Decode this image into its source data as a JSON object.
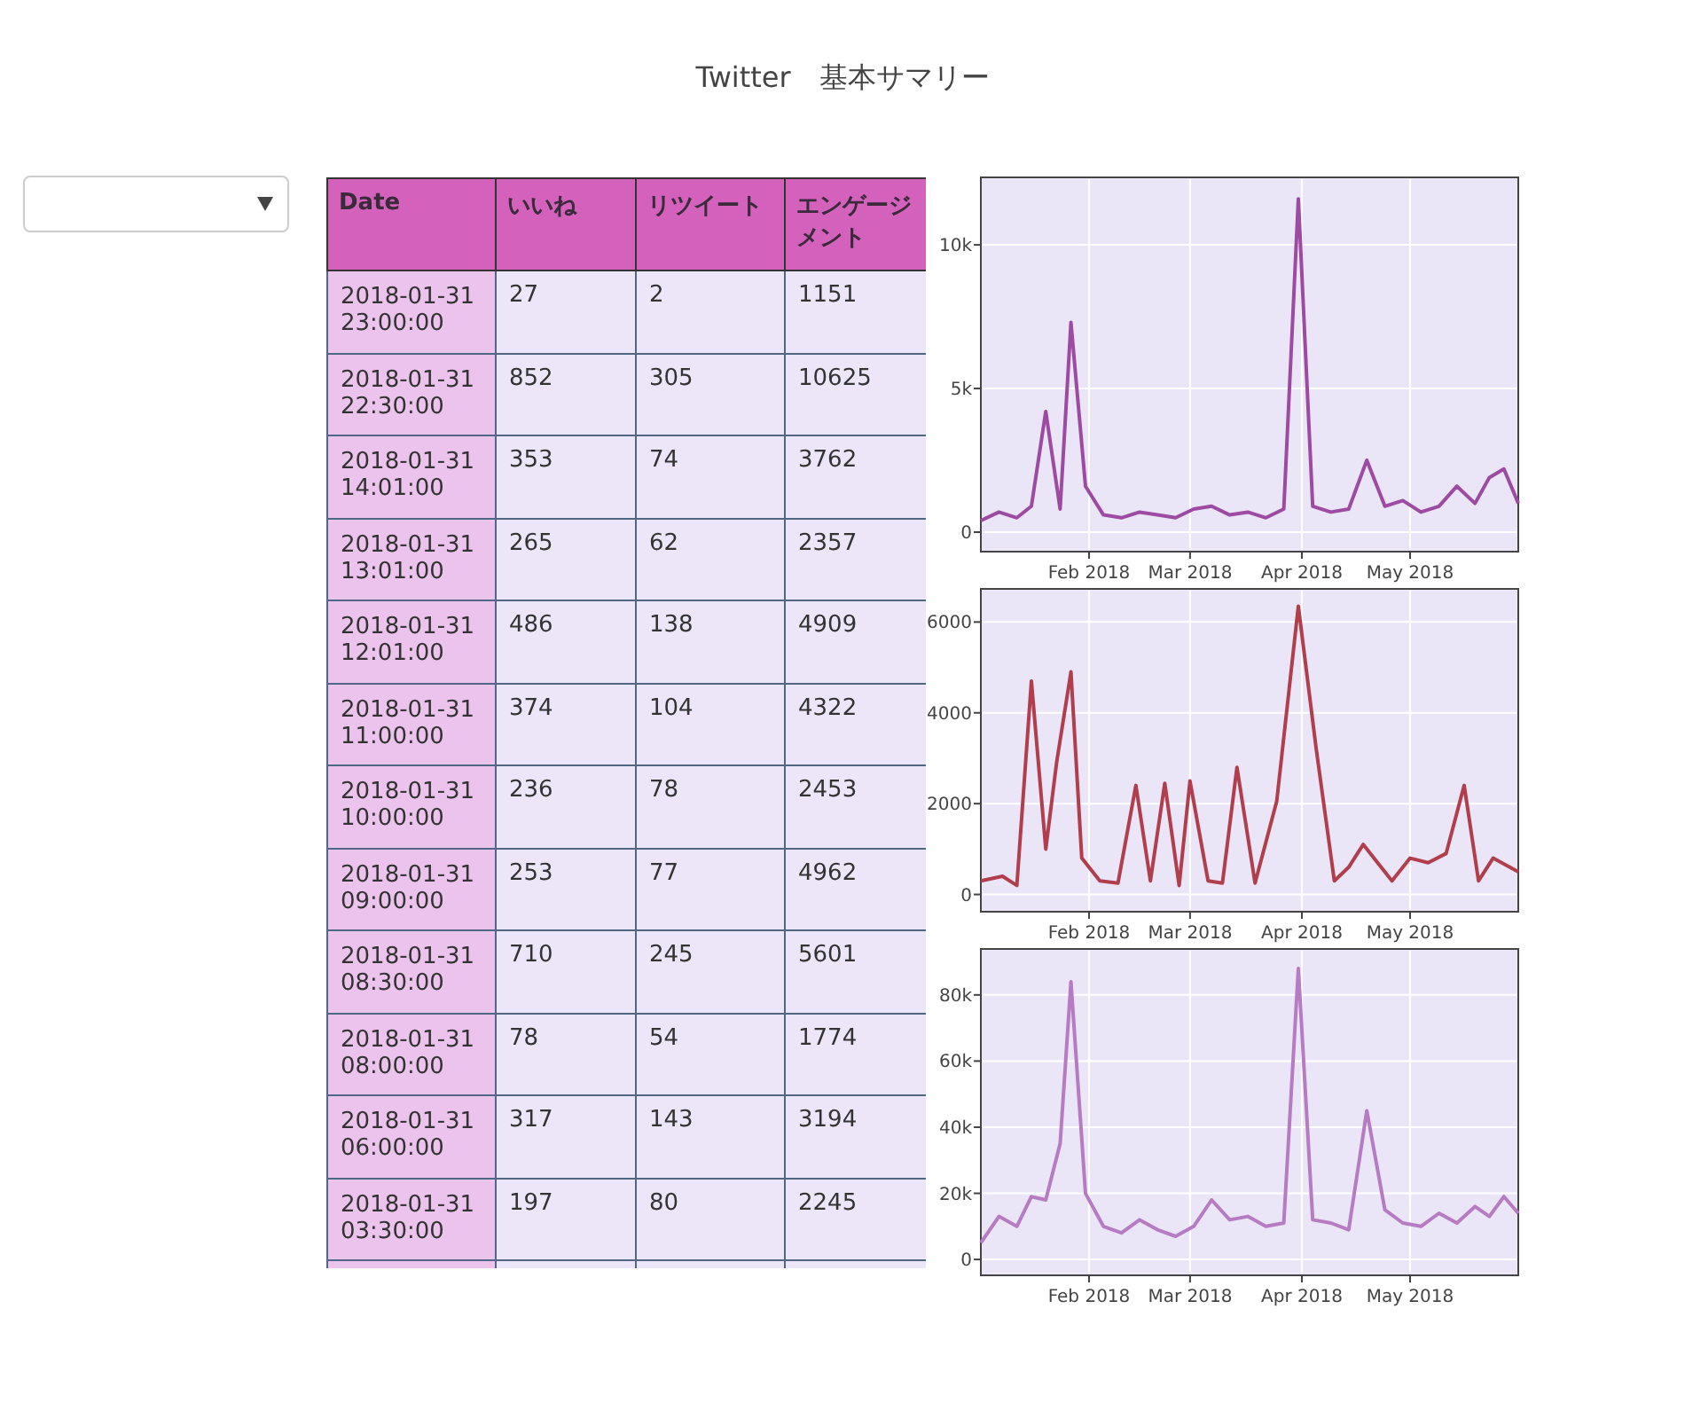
{
  "title": "Twitter　基本サマリー",
  "table": {
    "columns": [
      "Date",
      "いいね",
      "リツイート",
      "エンゲージメント"
    ],
    "rows": [
      [
        "2018-01-31 23:00:00",
        "27",
        "2",
        "1151"
      ],
      [
        "2018-01-31 22:30:00",
        "852",
        "305",
        "10625"
      ],
      [
        "2018-01-31 14:01:00",
        "353",
        "74",
        "3762"
      ],
      [
        "2018-01-31 13:01:00",
        "265",
        "62",
        "2357"
      ],
      [
        "2018-01-31 12:01:00",
        "486",
        "138",
        "4909"
      ],
      [
        "2018-01-31 11:00:00",
        "374",
        "104",
        "4322"
      ],
      [
        "2018-01-31 10:00:00",
        "236",
        "78",
        "2453"
      ],
      [
        "2018-01-31 09:00:00",
        "253",
        "77",
        "4962"
      ],
      [
        "2018-01-31 08:30:00",
        "710",
        "245",
        "5601"
      ],
      [
        "2018-01-31 08:00:00",
        "78",
        "54",
        "1774"
      ],
      [
        "2018-01-31 06:00:00",
        "317",
        "143",
        "3194"
      ],
      [
        "2018-01-31 03:30:00",
        "197",
        "80",
        "2245"
      ]
    ]
  },
  "charts": [
    {
      "chart_data": {
        "type": "line",
        "grid": true,
        "x": [
          "2018-01-02",
          "2018-01-07",
          "2018-01-12",
          "2018-01-16",
          "2018-01-20",
          "2018-01-24",
          "2018-01-27",
          "2018-01-31",
          "2018-02-05",
          "2018-02-10",
          "2018-02-15",
          "2018-02-20",
          "2018-02-25",
          "2018-03-02",
          "2018-03-07",
          "2018-03-12",
          "2018-03-17",
          "2018-03-22",
          "2018-03-27",
          "2018-03-31",
          "2018-04-04",
          "2018-04-09",
          "2018-04-14",
          "2018-04-19",
          "2018-04-24",
          "2018-04-29",
          "2018-05-04",
          "2018-05-09",
          "2018-05-14",
          "2018-05-19",
          "2018-05-23",
          "2018-05-27",
          "2018-05-31"
        ],
        "series": [
          {
            "color": "#9c4aa2",
            "values": [
              400,
              700,
              500,
              900,
              4200,
              800,
              7300,
              1600,
              600,
              500,
              700,
              600,
              500,
              800,
              900,
              600,
              700,
              500,
              800,
              11600,
              900,
              700,
              800,
              2500,
              900,
              1100,
              700,
              900,
              1600,
              1000,
              1900,
              2200,
              1000
            ]
          }
        ],
        "xlim": [
          "2018-01-02",
          "2018-05-31"
        ],
        "ylim": [
          -680,
          12350
        ],
        "xticks": [
          {
            "value": "2018-02-01",
            "label": "Feb 2018"
          },
          {
            "value": "2018-03-01",
            "label": "Mar 2018"
          },
          {
            "value": "2018-04-01",
            "label": "Apr 2018"
          },
          {
            "value": "2018-05-01",
            "label": "May 2018"
          }
        ],
        "yticks": [
          {
            "value": 0,
            "label": "0"
          },
          {
            "value": 5000,
            "label": "5k"
          },
          {
            "value": 10000,
            "label": "10k"
          }
        ]
      }
    },
    {
      "chart_data": {
        "type": "line",
        "grid": true,
        "x": [
          "2018-01-02",
          "2018-01-08",
          "2018-01-12",
          "2018-01-16",
          "2018-01-20",
          "2018-01-23",
          "2018-01-27",
          "2018-01-30",
          "2018-02-04",
          "2018-02-09",
          "2018-02-14",
          "2018-02-18",
          "2018-02-22",
          "2018-02-26",
          "2018-03-01",
          "2018-03-06",
          "2018-03-10",
          "2018-03-14",
          "2018-03-19",
          "2018-03-25",
          "2018-03-31",
          "2018-04-05",
          "2018-04-10",
          "2018-04-14",
          "2018-04-18",
          "2018-04-22",
          "2018-04-26",
          "2018-05-01",
          "2018-05-06",
          "2018-05-11",
          "2018-05-16",
          "2018-05-20",
          "2018-05-24",
          "2018-05-31"
        ],
        "series": [
          {
            "color": "#b03e4c",
            "values": [
              300,
              400,
              200,
              4700,
              1000,
              2900,
              4900,
              800,
              300,
              250,
              2400,
              300,
              2450,
              200,
              2500,
              300,
              250,
              2800,
              250,
              2050,
              6350,
              3200,
              300,
              600,
              1100,
              700,
              300,
              800,
              700,
              900,
              2400,
              300,
              800,
              500
            ]
          }
        ],
        "xlim": [
          "2018-01-02",
          "2018-05-31"
        ],
        "ylim": [
          -380,
          6730
        ],
        "xticks": [
          {
            "value": "2018-02-01",
            "label": "Feb 2018"
          },
          {
            "value": "2018-03-01",
            "label": "Mar 2018"
          },
          {
            "value": "2018-04-01",
            "label": "Apr 2018"
          },
          {
            "value": "2018-05-01",
            "label": "May 2018"
          }
        ],
        "yticks": [
          0,
          2000,
          4000,
          6000
        ]
      }
    },
    {
      "chart_data": {
        "type": "line",
        "grid": true,
        "x": [
          "2018-01-02",
          "2018-01-07",
          "2018-01-12",
          "2018-01-16",
          "2018-01-20",
          "2018-01-24",
          "2018-01-27",
          "2018-01-31",
          "2018-02-05",
          "2018-02-10",
          "2018-02-15",
          "2018-02-20",
          "2018-02-25",
          "2018-03-02",
          "2018-03-07",
          "2018-03-12",
          "2018-03-17",
          "2018-03-22",
          "2018-03-27",
          "2018-03-31",
          "2018-04-04",
          "2018-04-09",
          "2018-04-14",
          "2018-04-19",
          "2018-04-24",
          "2018-04-29",
          "2018-05-04",
          "2018-05-09",
          "2018-05-14",
          "2018-05-19",
          "2018-05-23",
          "2018-05-27",
          "2018-05-31"
        ],
        "series": [
          {
            "color": "#b67bc2",
            "values": [
              5000,
              13000,
              10000,
              19000,
              18000,
              35000,
              84000,
              20000,
              10000,
              8000,
              12000,
              9000,
              7000,
              10000,
              18000,
              12000,
              13000,
              10000,
              11000,
              88000,
              12000,
              11000,
              9000,
              45000,
              15000,
              11000,
              10000,
              14000,
              11000,
              16000,
              13000,
              19000,
              14000
            ]
          }
        ],
        "xlim": [
          "2018-01-02",
          "2018-05-31"
        ],
        "ylim": [
          -4800,
          93900
        ],
        "xticks": [
          {
            "value": "2018-02-01",
            "label": "Feb 2018"
          },
          {
            "value": "2018-03-01",
            "label": "Mar 2018"
          },
          {
            "value": "2018-04-01",
            "label": "Apr 2018"
          },
          {
            "value": "2018-05-01",
            "label": "May 2018"
          }
        ],
        "yticks": [
          {
            "value": 0,
            "label": "0"
          },
          {
            "value": 20000,
            "label": "20k"
          },
          {
            "value": 40000,
            "label": "40k"
          },
          {
            "value": 60000,
            "label": "60k"
          },
          {
            "value": 80000,
            "label": "80k"
          }
        ]
      }
    }
  ]
}
